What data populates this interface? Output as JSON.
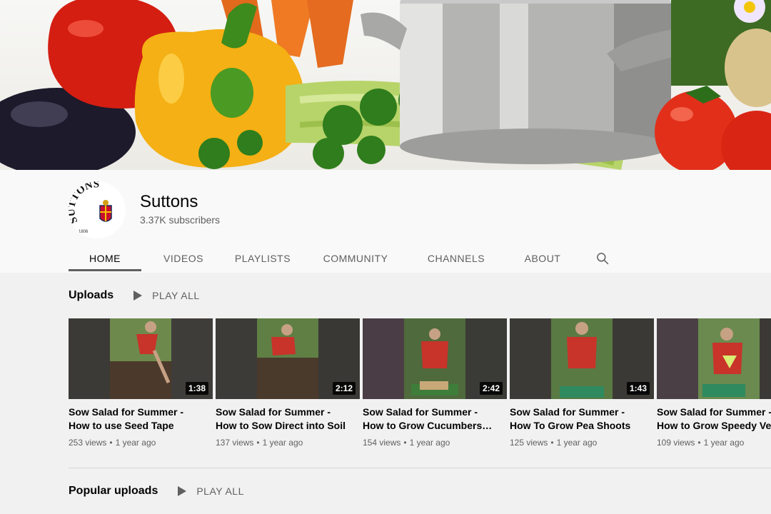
{
  "channel": {
    "name": "Suttons",
    "subscribers": "3.37K subscribers",
    "avatar_text": "SUTTONS",
    "avatar_year": "1806"
  },
  "tabs": [
    {
      "label": "HOME",
      "active": true
    },
    {
      "label": "VIDEOS"
    },
    {
      "label": "PLAYLISTS"
    },
    {
      "label": "COMMUNITY"
    },
    {
      "label": "CHANNELS"
    },
    {
      "label": "ABOUT"
    }
  ],
  "icons": {
    "search": "search-icon",
    "play": "play-icon"
  },
  "uploads": {
    "title": "Uploads",
    "play_all": "PLAY ALL",
    "videos": [
      {
        "title": "Sow Salad for Summer - How to use Seed Tape",
        "duration": "1:38",
        "views": "253 views",
        "age": "1 year ago"
      },
      {
        "title": "Sow Salad for Summer - How to Sow Direct into Soil",
        "duration": "2:12",
        "views": "137 views",
        "age": "1 year ago"
      },
      {
        "title": "Sow Salad for Summer - How to Grow Cucumbers and…",
        "duration": "2:42",
        "views": "154 views",
        "age": "1 year ago"
      },
      {
        "title": "Sow Salad for Summer - How To Grow Pea Shoots",
        "duration": "1:43",
        "views": "125 views",
        "age": "1 year ago"
      },
      {
        "title": "Sow Salad for Summer - How to Grow Speedy Veg",
        "duration": "",
        "views": "109 views",
        "age": "1 year ago"
      }
    ]
  },
  "popular": {
    "title": "Popular uploads",
    "play_all": "PLAY ALL"
  },
  "colors": {
    "text_primary": "#030303",
    "text_secondary": "#606060",
    "page_bg": "#f9f9f9",
    "content_bg": "#f1f1f1"
  }
}
